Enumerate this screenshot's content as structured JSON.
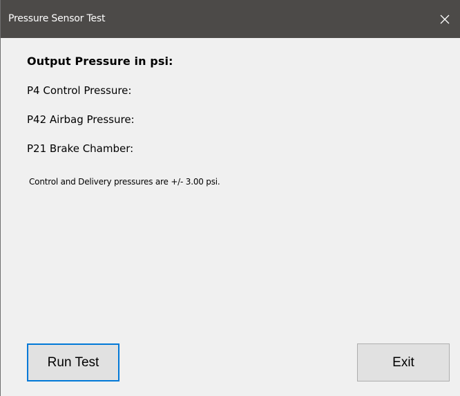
{
  "window": {
    "title": "Pressure Sensor Test",
    "close_glyph": "✕"
  },
  "main": {
    "heading": "Output Pressure in psi:",
    "readings": [
      {
        "label": "P4 Control Pressure:"
      },
      {
        "label": "P42 Airbag Pressure:"
      },
      {
        "label": "P21 Brake Chamber:"
      }
    ],
    "note": "Control and Delivery pressures are +/- 3.00 psi."
  },
  "buttons": {
    "run_label": "Run Test",
    "exit_label": "Exit"
  },
  "colors": {
    "titlebar": "#4c4a48",
    "accent_focus": "#0078d7",
    "window_bg": "#f0f0f0",
    "button_bg": "#e1e1e1"
  },
  "icons": {
    "close": "close-icon"
  }
}
